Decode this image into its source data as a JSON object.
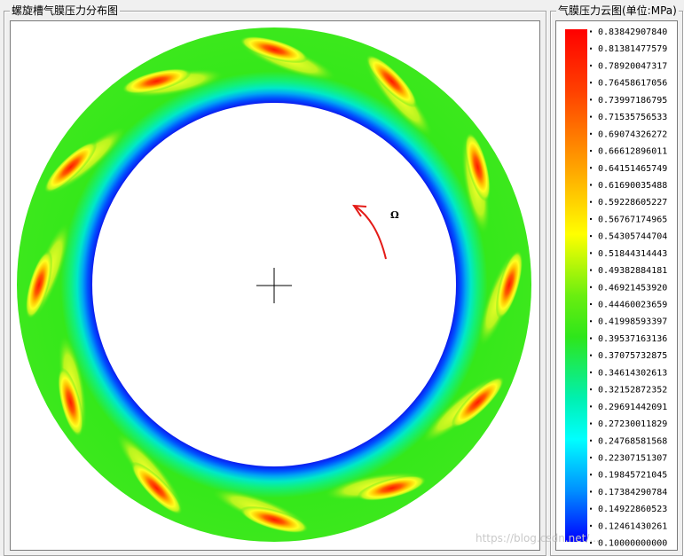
{
  "plot_group": {
    "title": "螺旋槽气膜压力分布图"
  },
  "legend_group": {
    "title": "气膜压力云图(单位:MPa)"
  },
  "plot": {
    "rotation_symbol": "Ω",
    "rotation_direction": "counter-clockwise",
    "groove_count": 12,
    "colors": {
      "arrow": "#e41b17",
      "crosshair": "#000000",
      "land": "#35e81a"
    }
  },
  "legend": {
    "colormap": [
      "#0000ff",
      "#00ffff",
      "#2ee61a",
      "#ffff00",
      "#ff0000"
    ],
    "values": [
      "0.83842907840",
      "0.81381477579",
      "0.78920047317",
      "0.76458617056",
      "0.73997186795",
      "0.71535756533",
      "0.69074326272",
      "0.66612896011",
      "0.64151465749",
      "0.61690035488",
      "0.59228605227",
      "0.56767174965",
      "0.54305744704",
      "0.51844314443",
      "0.49382884181",
      "0.46921453920",
      "0.44460023659",
      "0.41998593397",
      "0.39537163136",
      "0.37075732875",
      "0.34614302613",
      "0.32152872352",
      "0.29691442091",
      "0.27230011829",
      "0.24768581568",
      "0.22307151307",
      "0.19845721045",
      "0.17384290784",
      "0.14922860523",
      "0.12461430261",
      "0.10000000000"
    ]
  },
  "watermark": "https://blog.csdn.net/..."
}
